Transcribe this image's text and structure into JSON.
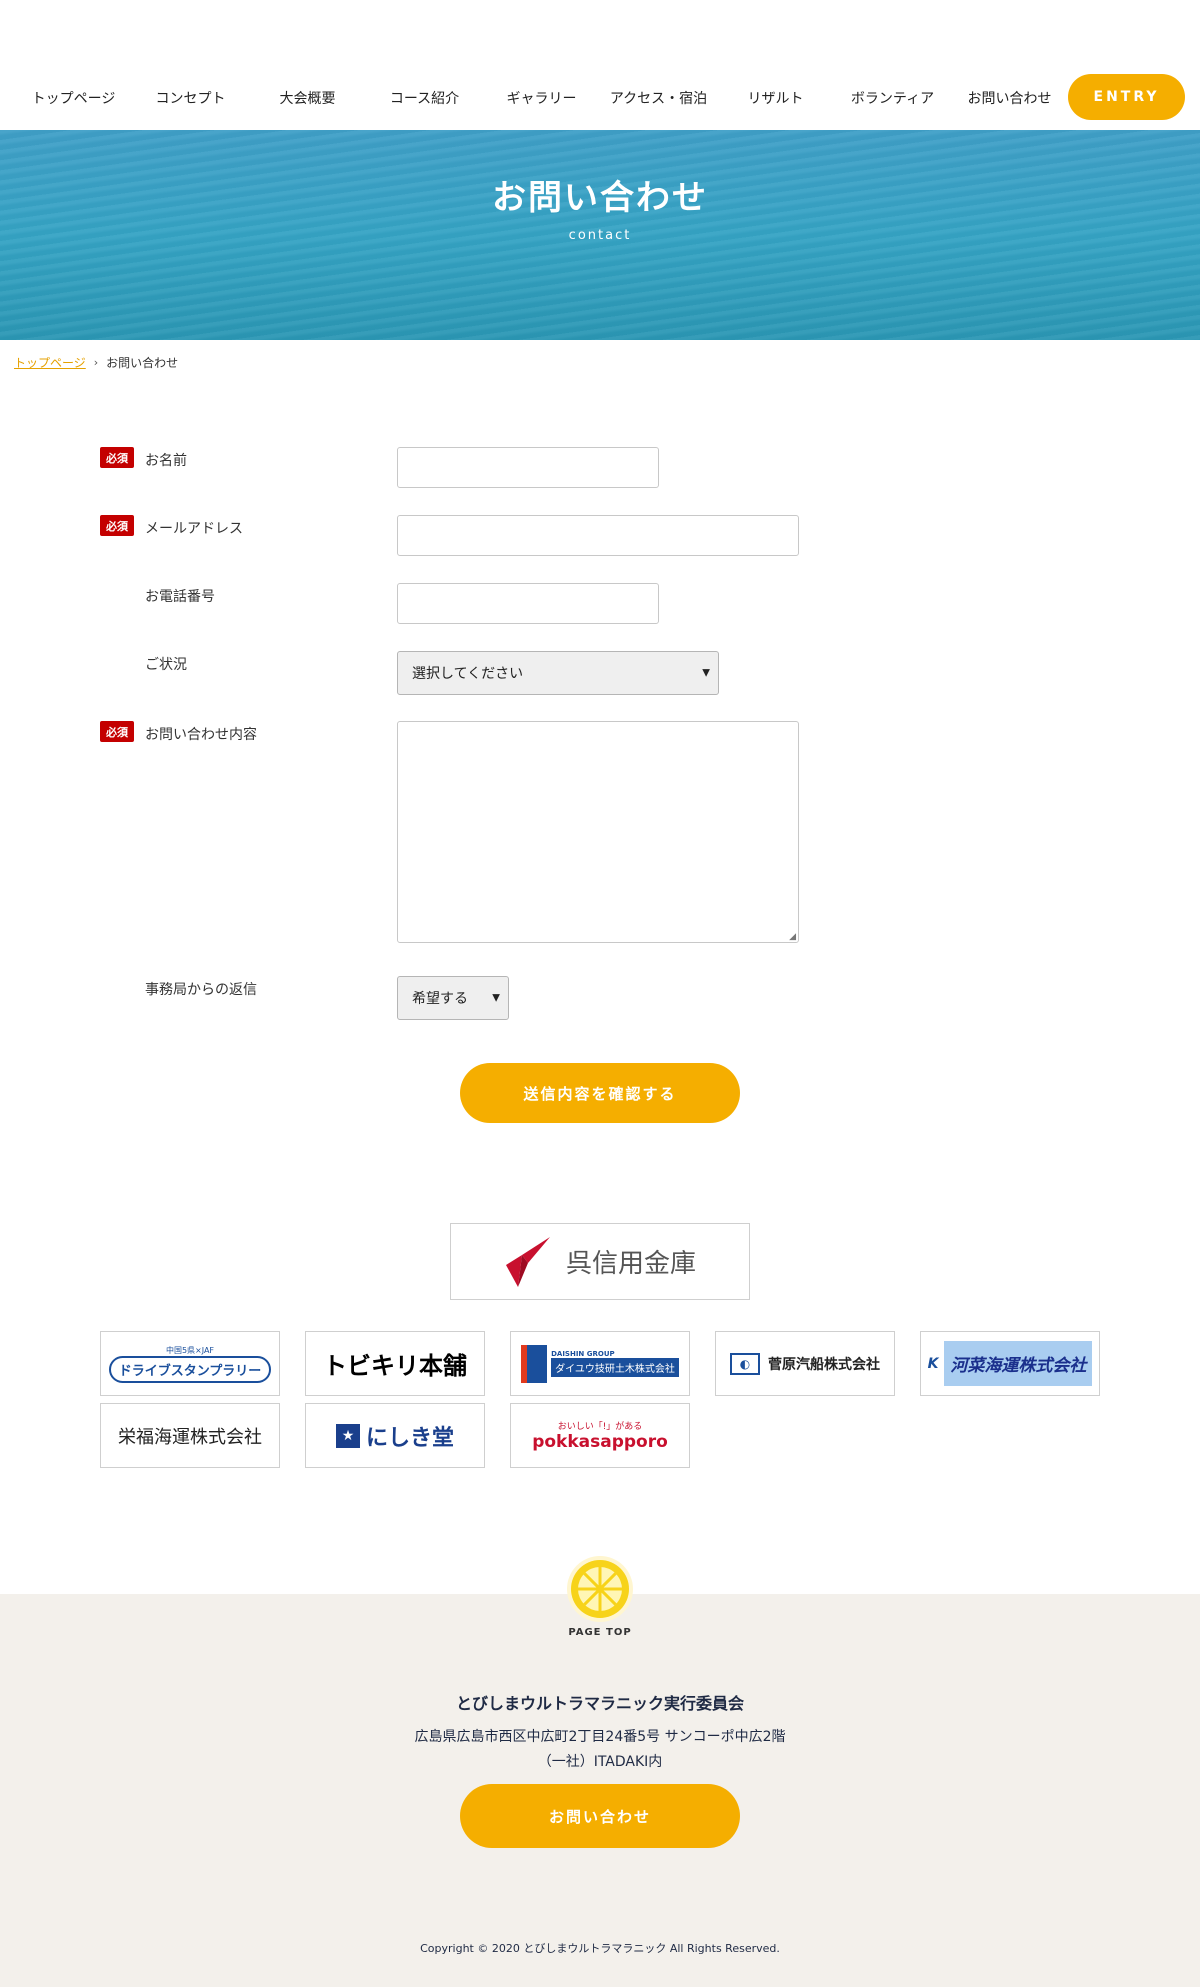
{
  "nav": {
    "items": [
      "トップページ",
      "コンセプト",
      "大会概要",
      "コース紹介",
      "ギャラリー",
      "アクセス・宿泊",
      "リザルト",
      "ボランティア",
      "お問い合わせ"
    ],
    "entry_label": "ENTRY"
  },
  "hero": {
    "title": "お問い合わせ",
    "subtitle": "contact"
  },
  "breadcrumb": {
    "home": "トップページ",
    "current": "お問い合わせ"
  },
  "form": {
    "required_badge": "必須",
    "name_label": "お名前",
    "email_label": "メールアドレス",
    "phone_label": "お電話番号",
    "status_label": "ご状況",
    "status_value": "選択してください",
    "inquiry_label": "お問い合わせ内容",
    "reply_label": "事務局からの返信",
    "reply_value": "希望する",
    "submit_label": "送信内容を確認する"
  },
  "sponsors": {
    "main": "呉信用金庫",
    "items": [
      "ドライブスタンプラリー",
      "トビキリ本舗",
      "ダイユウ技研土木株式会社",
      "菅原汽船株式会社",
      "河菜海運株式会社",
      "栄福海運株式会社",
      "にしき堂",
      "pokkasapporo"
    ],
    "drive_top": "中国5県×JAF",
    "daishin_group": "DAISHIN GROUP",
    "pokka_tagline": "おいしい「!」がある"
  },
  "footer": {
    "pagetop_label": "PAGE TOP",
    "org": "とびしまウルトラマラニック実行委員会",
    "address1": "広島県広島市西区中広町2丁目24番5号 サンコーポ中広2階",
    "address2": "（一社）ITADAKI内",
    "contact_label": "お問い合わせ",
    "copyright": "Copyright © 2020 とびしまウルトラマラニック All Rights Reserved."
  },
  "colors": {
    "accent": "#f5ae00",
    "required": "#c40000",
    "footer_bg": "#f3f0eb",
    "hero": "#35a3c4"
  }
}
